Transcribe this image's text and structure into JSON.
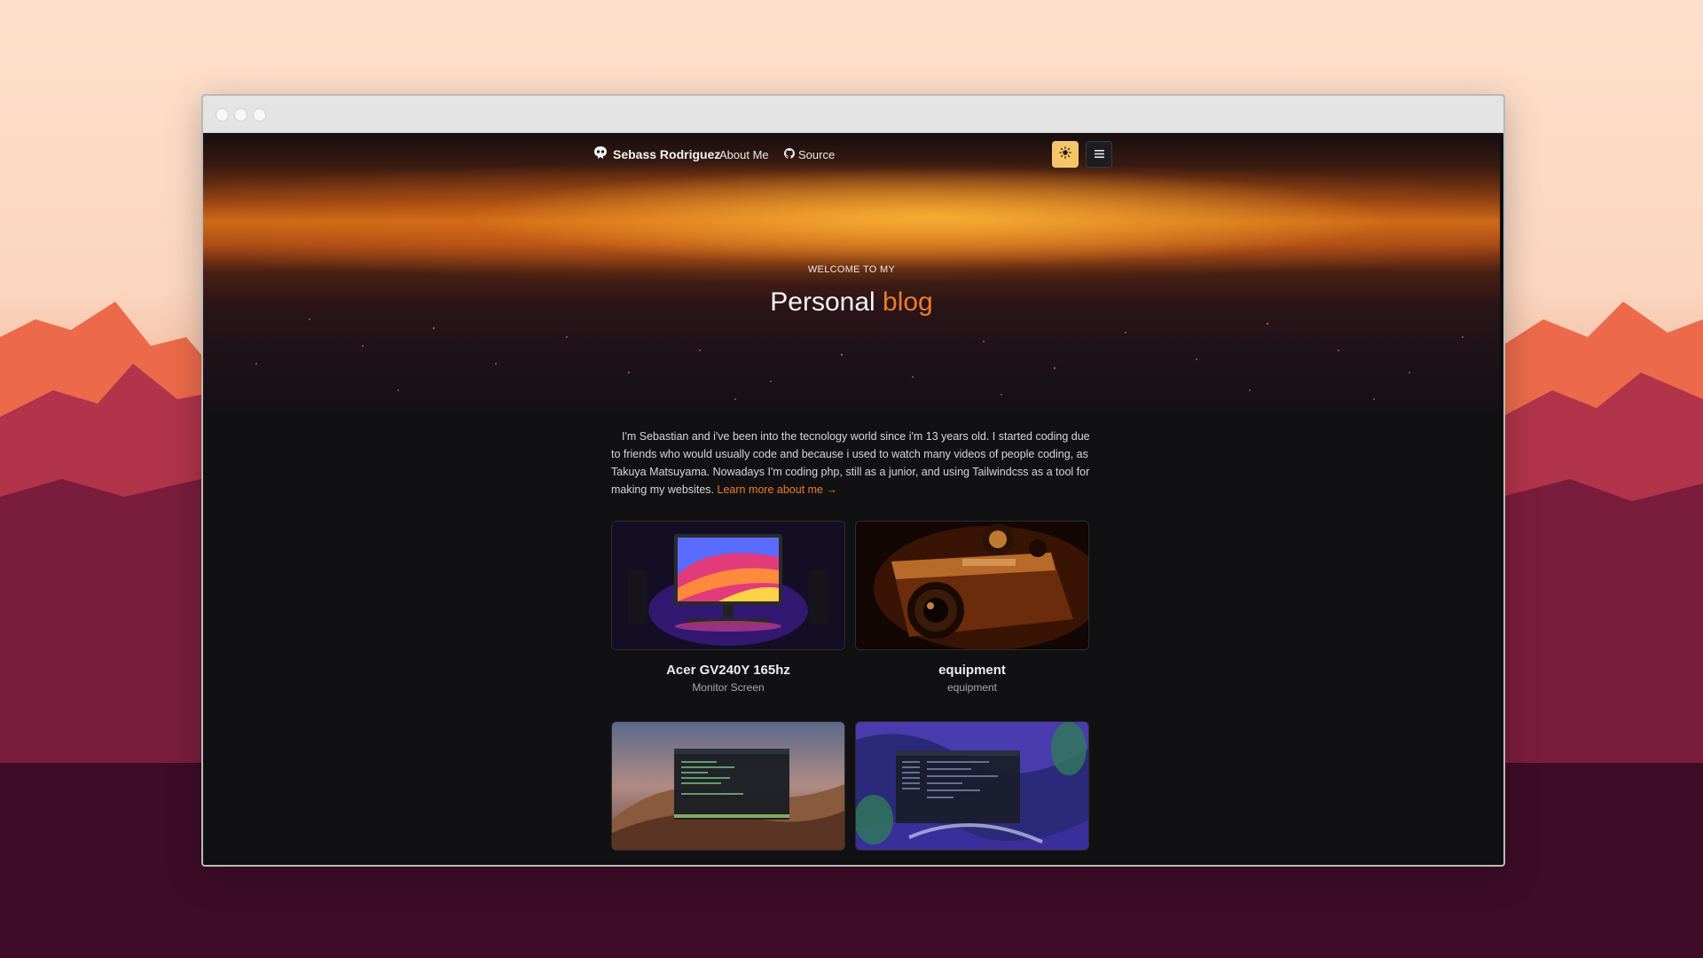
{
  "navbar": {
    "brand": "Sebass Rodriguez",
    "links": [
      {
        "label": "About Me"
      },
      {
        "label": "Source",
        "icon": "github-icon"
      }
    ],
    "theme_toggle_icon": "sun-icon",
    "menu_icon": "hamburger-menu-icon"
  },
  "hero": {
    "kicker": "WELCOME TO MY",
    "title_main": "Personal",
    "title_accent": "blog"
  },
  "intro": {
    "text": "I'm Sebastian and i've been into the tecnology world since i'm 13 years old. I started coding due to friends who would usually code and because i used to watch many videos of people coding, as Takuya Matsuyama. Nowadays I'm coding php, still as a junior, and using Tailwindcss as a tool for making my websites.",
    "link_label": "Learn more about me",
    "link_arrow": "→"
  },
  "cards": [
    {
      "title": "Acer GV240Y 165hz",
      "subtitle": "Monitor Screen"
    },
    {
      "title": "equipment",
      "subtitle": "equipment"
    },
    {
      "title": "",
      "subtitle": ""
    },
    {
      "title": "",
      "subtitle": ""
    }
  ],
  "colors": {
    "accent": "#f07a2a",
    "theme_button": "#f6c56b",
    "page_background": "#111113"
  }
}
